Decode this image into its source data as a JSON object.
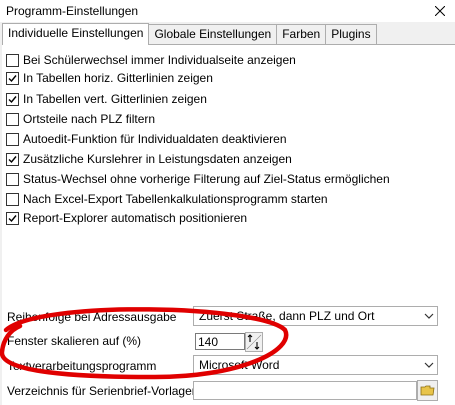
{
  "window": {
    "title": "Programm-Einstellungen",
    "close_icon": "close-icon"
  },
  "tabs": [
    {
      "label": "Individuelle Einstellungen",
      "active": true
    },
    {
      "label": "Globale Einstellungen",
      "active": false
    },
    {
      "label": "Farben",
      "active": false
    },
    {
      "label": "Plugins",
      "active": false
    }
  ],
  "checkboxes": [
    {
      "label": "Bei Schülerwechsel immer Individualseite anzeigen",
      "checked": false
    },
    {
      "label": "In Tabellen horiz. Gitterlinien zeigen",
      "checked": true
    },
    {
      "label": "In Tabellen vert. Gitterlinien zeigen",
      "checked": true
    },
    {
      "label": "Ortsteile nach PLZ filtern",
      "checked": false
    },
    {
      "label": "Autoedit-Funktion für Individualdaten deaktivieren",
      "checked": false
    },
    {
      "label": "Zusätzliche Kurslehrer in Leistungsdaten anzeigen",
      "checked": true
    },
    {
      "label": "Status-Wechsel ohne vorherige Filterung auf Ziel-Status ermöglichen",
      "checked": false
    },
    {
      "label": "Nach Excel-Export Tabellenkalkulationsprogramm starten",
      "checked": false
    },
    {
      "label": "Report-Explorer automatisch positionieren",
      "checked": true
    }
  ],
  "settings": {
    "address_order_label": "Reihenfolge bei Adressausgabe",
    "address_order_value": "Zuerst Straße, dann PLZ und Ort",
    "scale_label": "Fenster skalieren auf (%)",
    "scale_value": "140",
    "text_program_label": "Textverarbeitungsprogramm",
    "text_program_value": "Microsoft Word",
    "serial_letter_label": "Verzeichnis für Serienbrief-Vorlagen",
    "serial_letter_value": ""
  },
  "colors": {
    "annotation_red": "#e00000",
    "folder_yellow": "#e8c44a"
  }
}
